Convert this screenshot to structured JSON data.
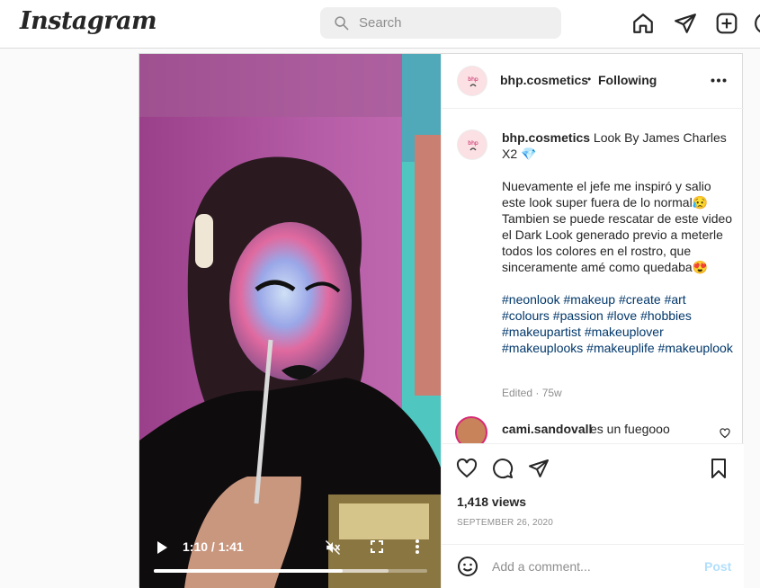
{
  "app": {
    "logo": "Instagram"
  },
  "search": {
    "placeholder": "Search"
  },
  "nav": {
    "icons": [
      "home-icon",
      "direct-icon",
      "new-post-icon",
      "explore-icon"
    ]
  },
  "video": {
    "time": "1:10 / 1:41",
    "progress": 0.69,
    "buffered": 0.86,
    "muted": true
  },
  "post": {
    "username": "bhp.cosmetics",
    "separator": "•",
    "follow_status": "Following",
    "caption": {
      "title": "Look By James Charles X2",
      "title_emoji": "💎",
      "body": "Nuevamente el jefe me inspiró y salio este look super fuera de lo normal😥 Tambien se puede rescatar de este video el Dark Look generado previo a meterle todos los colores en el rostro, que sinceramente amé como quedaba😍",
      "hashtags": "#neonlook #makeup #create #art #colours #passion #love #hobbies #makeupartist #makeuplover #makeuplooks #makeuplife #makeuplook"
    },
    "edited": "Edited · 75w",
    "comment": {
      "username": "cami.sandovall",
      "text": "es un fuegooo"
    },
    "views": "1,418 views",
    "date": "SEPTEMBER 26, 2020",
    "add_comment_placeholder": "Add a comment...",
    "post_button": "Post"
  },
  "colors": {
    "link": "#00376b",
    "post_disabled": "#b2dffc",
    "muted_text": "#8e8e8e"
  }
}
